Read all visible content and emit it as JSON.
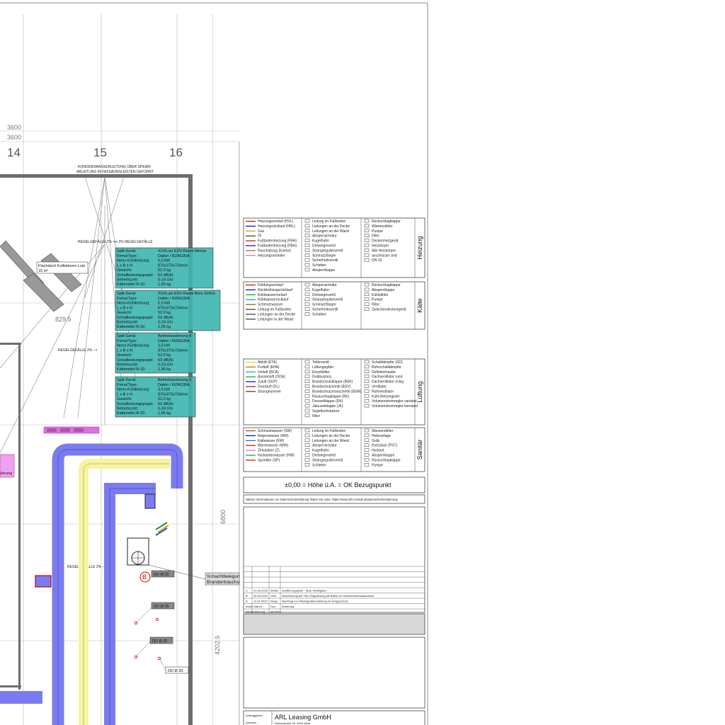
{
  "axes": {
    "dims": [
      "3600",
      "3600"
    ],
    "labels": [
      "14",
      "15",
      "16"
    ]
  },
  "plan_notes": {
    "condensate_line1": "KONDENSWASSERLEITUNG ÜBER SPEIER",
    "condensate_line2": "ABLEITUNG IN FASSADENLEISTEN GEFÜHRT",
    "slope_right": "<-- 2% REGELGEFÄLLE",
    "slope_left_1": "REGELGEFÄLLE 2% -->",
    "slope_left_2": "REGELGEFÄLLE 2% -->",
    "slope_left_3": "REGELGEFÄLLE 2% -->",
    "dim_829": "829.5",
    "dim_6800": "6800",
    "dim_4202": "4202.5",
    "collector_label": "Flachdach Kollektoren Lutz",
    "collector_area": "15 m²",
    "shaft_1": "Schachtbelegun",
    "shaft_2": "Brandentrauchu",
    "pink_label": "ührung",
    "marker_b": "B",
    "dd_1": "DD Ø 25",
    "dd_2": "DD Ø 25",
    "dd_3": "DD Ø 25",
    "dd_4": "DD Ø 30"
  },
  "split_units": [
    {
      "title": "Split-Gerät",
      "name": "XXXLutz EDV-Raum Mensa",
      "rows": [
        [
          "Firma/Type:",
          "Daikin / RZAG35A"
        ],
        [
          "Nenn-Kühlleistung:",
          "5,0 kW"
        ],
        [
          "L x B x H",
          "870x373x734mm"
        ],
        [
          "Gewicht:",
          "52,0 kg"
        ],
        [
          "Schallleistungspegel:",
          "63 dB(A)"
        ],
        [
          "Betriebszeit:",
          "0-24 Uhr"
        ],
        [
          "Kältemittel R-32:",
          "1,55 kg"
        ]
      ]
    },
    {
      "title": "Split-Gerät",
      "name": "XXXLutz EDV-Raum Büro SOKG",
      "rows": [
        [
          "Firma/Type:",
          "Daikin / RZAG35A"
        ],
        [
          "Nenn-Kühlleistung:",
          "5,0 kW"
        ],
        [
          "L x B x H",
          "870x373x734mm"
        ],
        [
          "Gewicht:",
          "52,0 kg"
        ],
        [
          "Schallleistungspegel:",
          "63 dB(A)"
        ],
        [
          "Betriebszeit:",
          "0-24 Uhr"
        ],
        [
          "Kältemittel R-32:",
          "1,55 kg"
        ]
      ]
    },
    {
      "title": "Split-Gerät",
      "name": "Betriebswohnung 4",
      "rows": [
        [
          "Firma/Type:",
          "Daikin / RZAG35A"
        ],
        [
          "Nenn-Kühlleistung:",
          "3,5 kW"
        ],
        [
          "L x B x H",
          "870x373x734mm"
        ],
        [
          "Gewicht:",
          "52,0 kg"
        ],
        [
          "Schallleistungspegel:",
          "63 dB(A)"
        ],
        [
          "Betriebszeit:",
          "0-24 Uhr"
        ],
        [
          "Kältemittel R-32:",
          "1,55 kg"
        ]
      ]
    },
    {
      "title": "Split-Gerät",
      "name": "Betriebswohnung 3",
      "rows": [
        [
          "Firma/Type:",
          "Daikin / RZAG35A"
        ],
        [
          "Nenn-Kühlleistung:",
          "3,5 kW"
        ],
        [
          "L x B x H",
          "870x373x734mm"
        ],
        [
          "Gewicht:",
          "52,0 kg"
        ],
        [
          "Schallleistungspegel:",
          "63 dB(A)"
        ],
        [
          "Betriebszeit:",
          "0-24 Uhr"
        ],
        [
          "Kältemittel R-32:",
          "1,55 kg"
        ]
      ]
    }
  ],
  "legend": {
    "heizung": {
      "label": "Heizung",
      "col1": [
        "Heizungsvorlauf (HVL)",
        "Heizungsrücklauf (HRL)",
        "Gas",
        "Öl",
        "Fußbodenheizung (FBH)",
        "Fußbodenheizung (FBH)",
        "Rauchabzug (Kamin)",
        "Heizungsverteiler"
      ],
      "col1_colors": [
        "#cc0000",
        "#0000cc",
        "#cc9900",
        "#333333",
        "#cc0000",
        "#0000cc",
        "#aa6600",
        "#cc66cc"
      ],
      "col2": [
        "Leitung im Fußboden",
        "Leitungen an der Decke",
        "Leitungen an der Wand",
        "Absperrarmatur",
        "Kugelhahn",
        "Dreiwegeventil",
        "Strangregulierventil",
        "Schmutzfänger",
        "Sicherheitsventil",
        "Schieber",
        "Absperrklappe"
      ],
      "col3": [
        "Rückschlagklappe",
        "Wärmezähler",
        "Pumpe",
        "Filter",
        "Deckenheizgerät",
        "Heizkörper",
        "Alle Heizkörper-",
        "anschlüsse sind",
        "DN 15"
      ]
    },
    "kaelte": {
      "label": "Kälte",
      "col1": [
        "Kühlungsvorlauf",
        "Rückkühlungsrücklauf",
        "Kühlwasservorlauf",
        "Kühlwasserrücklauf",
        "Schmutzwasser",
        "Leitung im Fußboden",
        "Leitungen an der Decke",
        "Leitungen in der Wand"
      ],
      "col1_colors": [
        "#cc0000",
        "#0000cc",
        "#00aa00",
        "#009999",
        "#885500",
        "#333333",
        "#333333",
        "#333333"
      ],
      "col2": [
        "Absperrarmatur",
        "Kugelhahn",
        "Dreiwegeventil",
        "Strangregulierventil",
        "Schmutzfänger",
        "Sicherheitsventil",
        "Schieber"
      ],
      "col3": [
        "Rückschlagklappe",
        "Absperrklappe",
        "Kühlzähler",
        "Pumpe",
        "Filter",
        "Zwischendeckengerät"
      ]
    },
    "lueftung": {
      "label": "Lüftung",
      "col1": [
        "Abluft (ETA)",
        "Fortluft (EHA)",
        "Umluft (RCA)",
        "Aussenluft (ODA)",
        "Zuluft (SUP)",
        "Druckluft (DL)",
        "Strangnummer"
      ],
      "col1_colors": [
        "#dddd00",
        "#cc6600",
        "#00aaaa",
        "#00aa00",
        "#0000cc",
        "#cc0000",
        "#333333"
      ],
      "col2": [
        "Tellerventil",
        "Lüftungsgitter",
        "Einzellüfter",
        "Drallauslass",
        "Brandschutzklappe (BSK)",
        "Brandschutzventil (BSV)",
        "Brandschutzmanschette (BSM)",
        "Rückschlagklappe (RK)",
        "Drosselklappe (DK)",
        "Jalousieklappe (JK)",
        "Segeltuchstutzen",
        "Filter"
      ],
      "col3": [
        "Schalldämpfer (SD)",
        "Rohrschalldämpfer",
        "Deflektorhaube",
        "Dachventilator rund",
        "Dachventilator eckig",
        "Ventilator",
        "Rohrventilator",
        "Kühl-/Heizregister",
        "Volumenstromregler variabel",
        "Volumenstromregler konstant"
      ]
    },
    "sanitaer": {
      "label": "Sanitär",
      "col1": [
        "Schmutzwasser (SW)",
        "Regenwasser (RW)",
        "Kaltwasser (KW)",
        "Warmwasser (WW)",
        "Zirkulation (Z)",
        "Hydrantenwasser (HW)",
        "Sprinkler (SP)"
      ],
      "col1_colors": [
        "#885500",
        "#0000cc",
        "#0066cc",
        "#cc0000",
        "#cc66cc",
        "#00aa00",
        "#cc0000"
      ],
      "col2": [
        "Leitung im Fußboden",
        "Leitungen an der Decke",
        "Leitungen an der Wand",
        "Absperrarmatur",
        "Kugelhahn",
        "Dreiwegeventil",
        "Strangregulierventil",
        "Schieber"
      ],
      "col3": [
        "Wasserzähler",
        "Hebeanlage",
        "Gully",
        "Putzstück (PST)",
        "Hydrant",
        "Absperrklappe",
        "Rückschlagklappe",
        "Pumpe"
      ]
    }
  },
  "titleblock": {
    "reference": "±0,00 = Höhe ü.A. = OK Bezugspunkt",
    "info_url": "Nähere Informationen zur Datenschutzerklärung finden Sie unter: https://www.arb-consult.at/datenschutzerklaerung/",
    "revisions": [
      {
        "idx": "C",
        "date": "21.06.2023",
        "by": "Wolfer",
        "text": "Ausführungsplan · Nutz: Richtigkeit"
      },
      {
        "idx": "B",
        "date": "04.03.2023",
        "by": "Over",
        "text": "Nachführung der HKL-Regulierung als Basis zur Kleinsterwerbsaufnahme"
      },
      {
        "idx": "A",
        "date": "11.01.2023",
        "by": "Klepp",
        "text": "Nachtrag von Wandgeräteverteilung im Erdgeschoss"
      },
      {
        "idx": "Index",
        "date": "Datum",
        "by": "Gez.",
        "text": "Änderung"
      }
    ],
    "plan_status_label": "Auftraggeber",
    "plan_date_label": "Inkraft-Planung",
    "plan_date": "05.2023",
    "client_label": "Auftraggeber:",
    "client": "ARL Leasing GmbH",
    "address_label": "Adresse:",
    "address": "Römerstraße 25, 4600 Wels"
  },
  "colors": {
    "duct_blue": "#7b7bf0",
    "duct_yellow": "#f6f3a1",
    "split_fill": "#3cb5b0",
    "pink": "#e88ee0",
    "magenta": "#cc44cc",
    "wall": "#6d6d6d"
  }
}
